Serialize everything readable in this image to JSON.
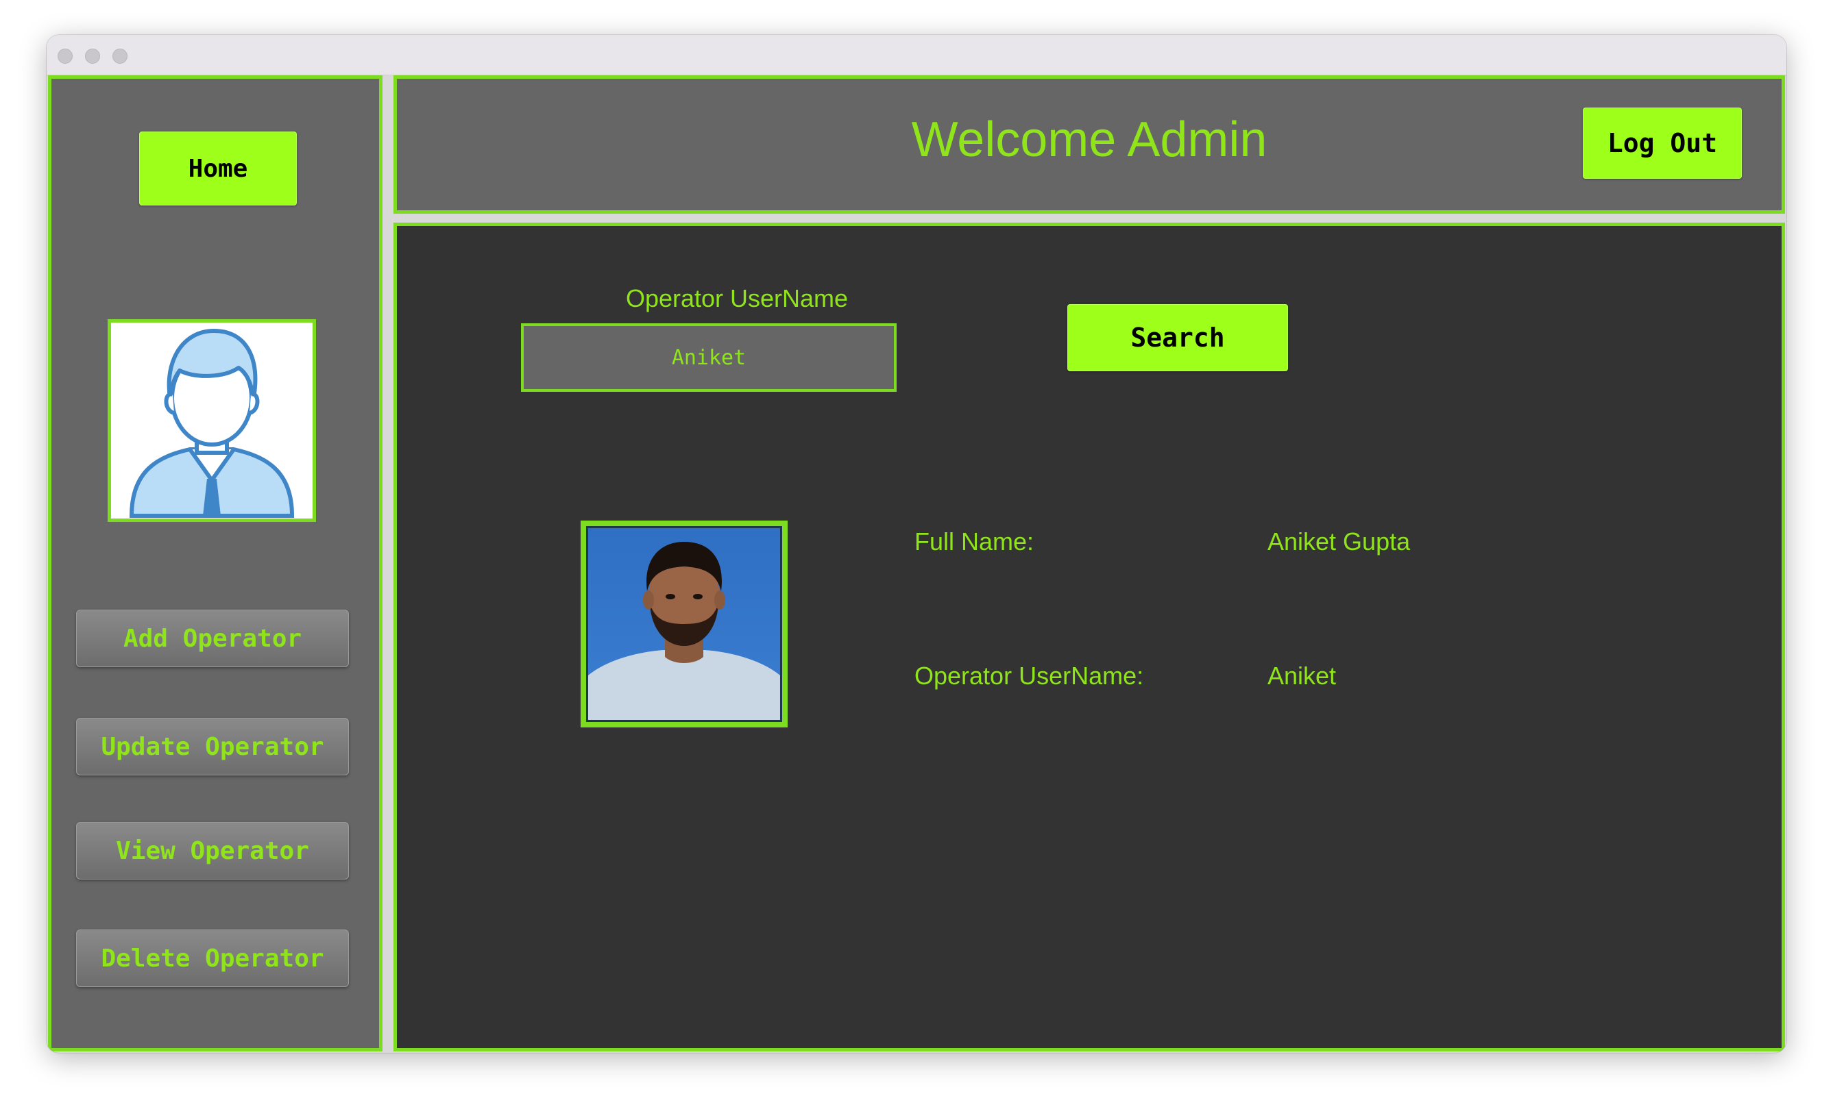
{
  "sidebar": {
    "home_label": "Home",
    "avatar_icon": "user-avatar-icon",
    "items": [
      {
        "label": "Add Operator"
      },
      {
        "label": "Update Operator"
      },
      {
        "label": "View Operator"
      },
      {
        "label": "Delete Operator"
      }
    ]
  },
  "header": {
    "title": "Welcome Admin",
    "logout_label": "Log Out"
  },
  "search": {
    "label": "Operator UserName",
    "value": "Aniket",
    "button_label": "Search"
  },
  "result": {
    "full_name_label": "Full Name:",
    "full_name_value": "Aniket Gupta",
    "username_label": "Operator UserName:",
    "username_value": "Aniket"
  },
  "colors": {
    "accent": "#7ddc1f",
    "button_green": "#9dff1a",
    "text_green": "#8fe51a",
    "panel_gray": "#666666",
    "main_dark": "#333333"
  }
}
